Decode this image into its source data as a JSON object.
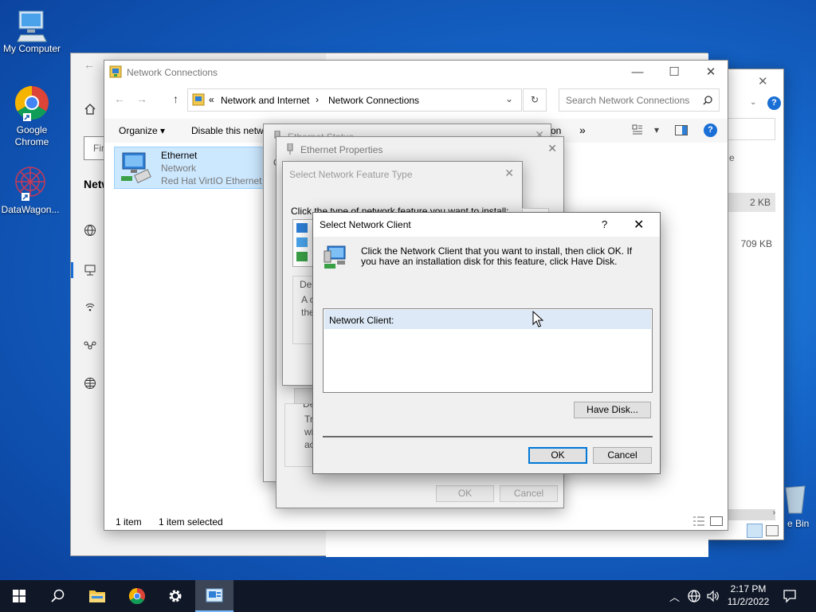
{
  "desktop": {
    "icons": [
      {
        "label": "My Computer"
      },
      {
        "label": "Google\nChrome"
      },
      {
        "label": "DataWagon..."
      },
      {
        "label": "e Bin"
      }
    ]
  },
  "bg_window": {
    "col_type_partial": "e",
    "sizes": [
      "2 KB",
      "709 KB"
    ]
  },
  "explorer": {
    "title": "Network Connections",
    "breadcrumb": [
      "Network and Internet",
      "Network Connections"
    ],
    "search_placeholder": "Search Network Connections",
    "toolbar": {
      "organize": "Organize",
      "disable": "Disable this netwo",
      "more_partial": "on",
      "overflow": "»"
    },
    "left_partial": {
      "find": "Fir",
      "network": "Netw"
    },
    "item": {
      "name": "Ethernet",
      "status": "Network",
      "device": "Red Hat VirtIO Ethernet A"
    },
    "status_bar": {
      "count": "1 item",
      "selected": "1 item selected"
    }
  },
  "ethernet_status": {
    "title": "Ethernet Status",
    "left_letter": "G"
  },
  "ethernet_properties": {
    "title": "Ethernet Properties",
    "partial_desc_label": "Des",
    "partial_desc_lines": [
      "Tra",
      "wi",
      "ac"
    ],
    "ok": "OK",
    "cancel": "Cancel"
  },
  "feature_type": {
    "title": "Select Network Feature Type",
    "instruction": "Click the type of network feature you want to install:",
    "desc_label": "Des",
    "desc_lines": [
      "A c",
      "the"
    ]
  },
  "client_dialog": {
    "title": "Select Network Client",
    "help": "?",
    "close": "✕",
    "message": "Click the Network Client that you want to install, then click OK. If you have an installation disk for this feature, click Have Disk.",
    "list_header": "Network Client:",
    "have_disk": "Have Disk...",
    "ok": "OK",
    "cancel": "Cancel"
  },
  "taskbar": {
    "time": "2:17 PM",
    "date": "11/2/2022"
  }
}
